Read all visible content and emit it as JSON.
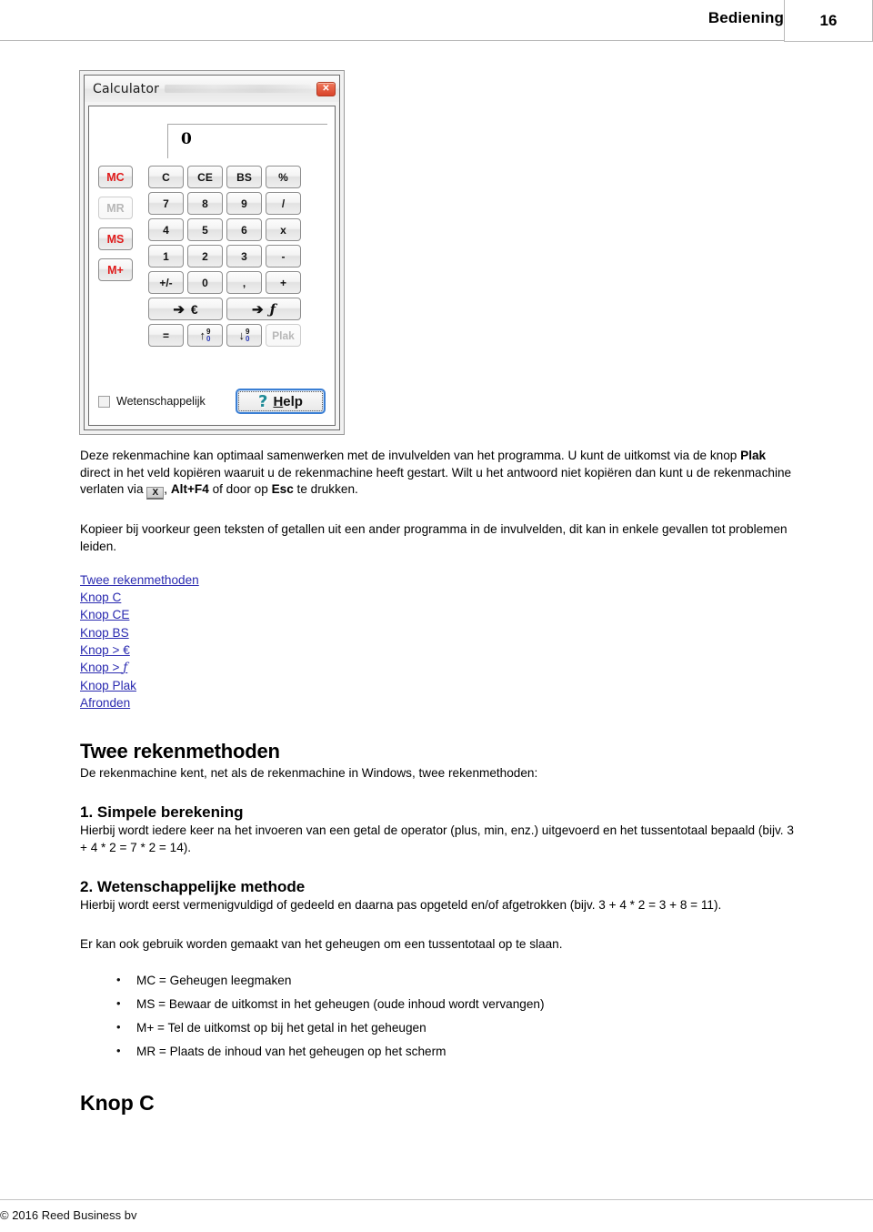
{
  "header": {
    "title": "Bediening",
    "page_number": "16"
  },
  "calculator": {
    "window_title": "Calculator",
    "close_icon": "close-icon",
    "display_value": "0",
    "memory_buttons": [
      {
        "label": "MC",
        "state": "enabled"
      },
      {
        "label": "MR",
        "state": "disabled"
      },
      {
        "label": "MS",
        "state": "enabled"
      },
      {
        "label": "M+",
        "state": "enabled"
      }
    ],
    "keys": [
      "C",
      "CE",
      "BS",
      "%",
      "7",
      "8",
      "9",
      "/",
      "4",
      "5",
      "6",
      "x",
      "1",
      "2",
      "3",
      "-",
      "+/-",
      "0",
      ",",
      "+"
    ],
    "convert_euro": {
      "arrow": "➔",
      "symbol": "€"
    },
    "convert_guilder": {
      "arrow": "➔",
      "symbol": "ƒ"
    },
    "equals_label": "=",
    "round_up": {
      "arrow": "↑",
      "top": "9",
      "bottom": "0"
    },
    "round_down": {
      "arrow": "↓",
      "top": "9",
      "bottom": "0"
    },
    "paste_label": "Plak",
    "paste_state": "disabled",
    "checkbox_label": "Wetenschappelijk",
    "checkbox_checked": false,
    "help_button": {
      "icon": "question-mark-icon",
      "label_prefix": "H",
      "label_rest": "elp"
    }
  },
  "body": {
    "p1_part1": "Deze rekenmachine kan optimaal samenwerken met de invulvelden van het programma. U kunt de uitkomst via de knop ",
    "p1_bold1": "Plak",
    "p1_part2": " direct in het veld kopiëren waaruit u de rekenmachine heeft gestart. Wilt u het antwoord niet kopiëren dan kunt u de rekenmachine verlaten via ",
    "p1_icon": "X",
    "p1_part3": ", ",
    "p1_bold2": "Alt+F4",
    "p1_part4": " of door op ",
    "p1_bold3": "Esc",
    "p1_part5": " te drukken.",
    "p2": "Kopieer bij voorkeur geen teksten of getallen uit een ander programma in de invulvelden, dit kan in enkele gevallen tot problemen leiden."
  },
  "links": [
    {
      "label": "Twee rekenmethoden"
    },
    {
      "label": "Knop C"
    },
    {
      "label": "Knop CE"
    },
    {
      "label": "Knop BS"
    },
    {
      "label": "Knop > €"
    },
    {
      "label": "Knop > ",
      "italic_suffix": "ƒ"
    },
    {
      "label": "Knop Plak"
    },
    {
      "label": "Afronden"
    }
  ],
  "sections": {
    "twee_rekenmethoden": {
      "heading": "Twee rekenmethoden",
      "intro": "De rekenmachine kent, net als de rekenmachine in Windows, twee rekenmethoden:"
    },
    "simpele": {
      "heading": "1. Simpele berekening",
      "text": "Hierbij wordt iedere keer na het invoeren van een getal de operator (plus, min, enz.) uitgevoerd en het tussentotaal bepaald (bijv. 3 + 4 * 2 = 7 * 2 = 14)."
    },
    "wetenschappelijke": {
      "heading": "2. Wetenschappelijke methode",
      "text": "Hierbij wordt eerst vermenigvuldigd of gedeeld en daarna pas opgeteld en/of afgetrokken (bijv. 3 + 4 * 2 = 3 + 8 = 11)."
    },
    "geheugen_intro": "Er kan ook gebruik worden gemaakt van het geheugen om een tussentotaal op te slaan.",
    "memory_items": [
      "MC = Geheugen leegmaken",
      "MS = Bewaar de uitkomst in het geheugen (oude inhoud wordt vervangen)",
      "M+ = Tel de uitkomst op bij het getal in het geheugen",
      "MR = Plaats de inhoud van het geheugen op het scherm"
    ],
    "knop_c_heading": "Knop C"
  },
  "footer": {
    "copyright": "© 2016 Reed Business bv"
  },
  "colors": {
    "link": "#2a2ab0",
    "memory_red": "#e01b1b",
    "close_red": "#d9432a",
    "help_teal": "#1f8a96",
    "rule": "#c3c3c3"
  }
}
